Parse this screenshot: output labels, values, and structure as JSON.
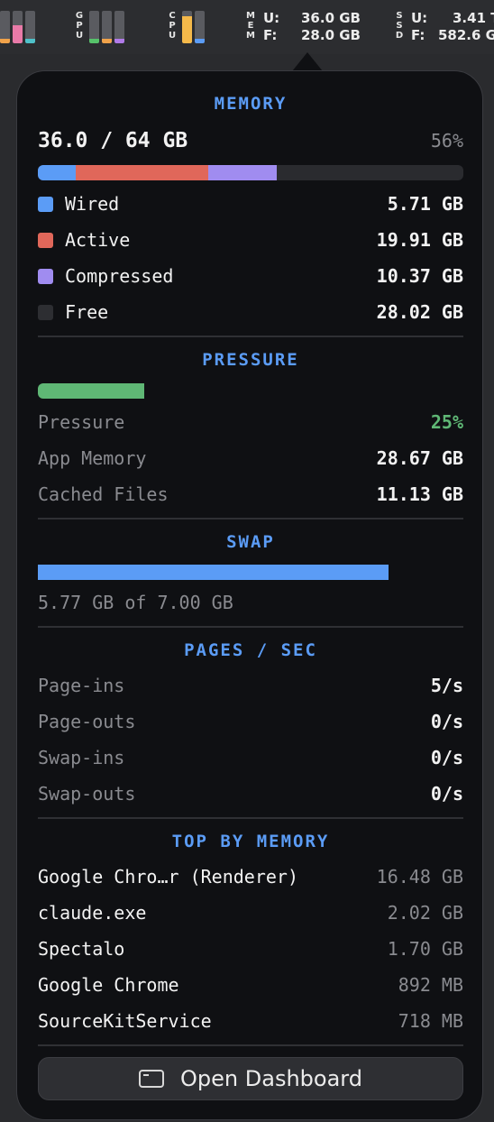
{
  "menubar": {
    "gpu_label": [
      "G",
      "P",
      "U"
    ],
    "cpu_label": [
      "C",
      "P",
      "U"
    ],
    "mem_label": [
      "M",
      "E",
      "M"
    ],
    "ssd_label": [
      "S",
      "S",
      "D"
    ],
    "mem_used_key": "U:",
    "mem_used_value": "36.0 GB",
    "mem_free_key": "F:",
    "mem_free_value": "28.0 GB",
    "ssd_used_key": "U:",
    "ssd_used_value": "3.41 T",
    "ssd_free_key": "F:",
    "ssd_free_value": "582.6 G",
    "colors": {
      "orange": "#f0a24a",
      "pink": "#e97aa8",
      "teal": "#4fc1c9",
      "green": "#56c26a",
      "purple": "#b07ae8",
      "blue": "#5b9cf6",
      "yellow": "#f5b94a"
    }
  },
  "memory": {
    "title": "MEMORY",
    "total_text": "36.0 / 64 GB",
    "percent_text": "56%",
    "segments": [
      {
        "key": "wired",
        "fraction": 0.089,
        "color": "#5b9cf6"
      },
      {
        "key": "active",
        "fraction": 0.311,
        "color": "#e0675a"
      },
      {
        "key": "compressed",
        "fraction": 0.162,
        "color": "#a08cf0"
      }
    ],
    "legend": [
      {
        "label": "Wired",
        "value": "5.71 GB",
        "color": "#5b9cf6"
      },
      {
        "label": "Active",
        "value": "19.91 GB",
        "color": "#e0675a"
      },
      {
        "label": "Compressed",
        "value": "10.37 GB",
        "color": "#a08cf0"
      },
      {
        "label": "Free",
        "value": "28.02 GB",
        "color": "#2d2e32"
      }
    ]
  },
  "pressure": {
    "title": "PRESSURE",
    "fraction": 0.25,
    "bar_color": "#5fb775",
    "rows": [
      {
        "label": "Pressure",
        "value": "25%",
        "value_color": "#5fb775"
      },
      {
        "label": "App Memory",
        "value": "28.67 GB"
      },
      {
        "label": "Cached Files",
        "value": "11.13 GB"
      }
    ]
  },
  "swap": {
    "title": "SWAP",
    "fraction": 0.824,
    "bar_color": "#5b9cf6",
    "caption": "5.77 GB of 7.00 GB"
  },
  "pages": {
    "title": "PAGES / SEC",
    "rows": [
      {
        "label": "Page-ins",
        "value": "5/s"
      },
      {
        "label": "Page-outs",
        "value": "0/s"
      },
      {
        "label": "Swap-ins",
        "value": "0/s"
      },
      {
        "label": "Swap-outs",
        "value": "0/s"
      }
    ]
  },
  "top": {
    "title": "TOP BY MEMORY",
    "rows": [
      {
        "label": "Google Chro…r (Renderer)",
        "value": "16.48 GB"
      },
      {
        "label": "claude.exe",
        "value": "2.02 GB"
      },
      {
        "label": "Spectalo",
        "value": "1.70 GB"
      },
      {
        "label": "Google Chrome",
        "value": "892 MB"
      },
      {
        "label": "SourceKitService",
        "value": "718 MB"
      }
    ]
  },
  "footer": {
    "button_label": "Open Dashboard"
  }
}
